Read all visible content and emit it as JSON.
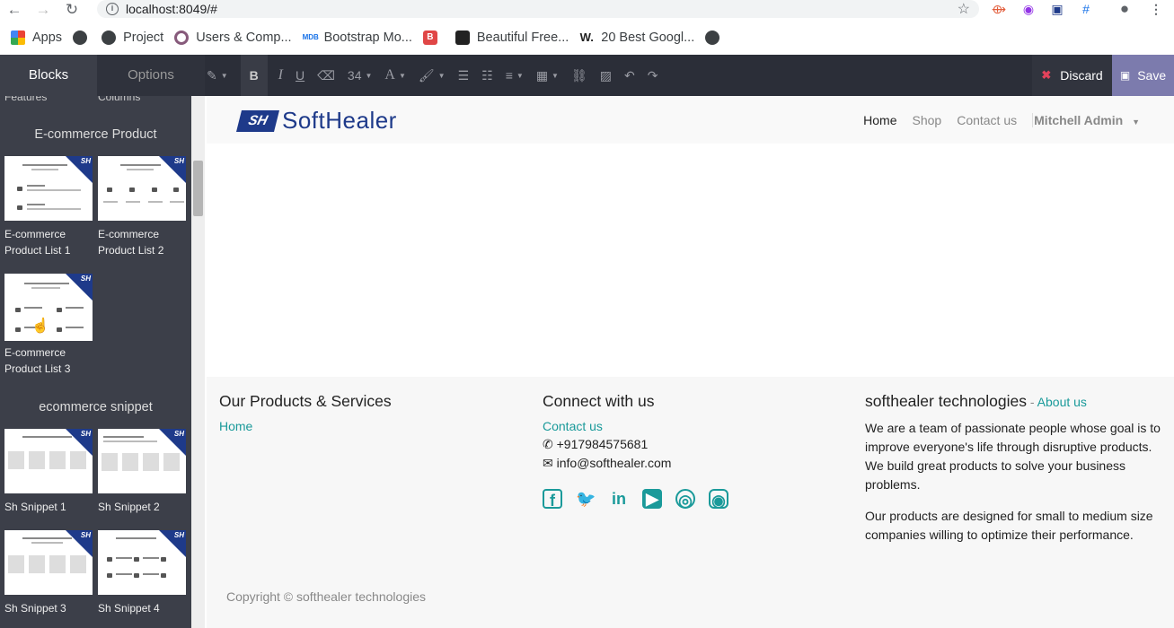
{
  "browser": {
    "url": "localhost:8049/#",
    "bookmarks": [
      "Apps",
      "Project",
      "Users & Comp...",
      "Bootstrap Mo...",
      "Beautiful Free...",
      "20 Best Googl..."
    ]
  },
  "editor": {
    "tabs": {
      "blocks": "Blocks",
      "options": "Options"
    },
    "font_size": "34",
    "discard_label": "Discard",
    "save_label": "Save"
  },
  "sidebar": {
    "cut_labels": [
      "Features",
      "Columns"
    ],
    "section1_title": "E-commerce Product",
    "section1_items": [
      "E-commerce Product List 1",
      "E-commerce Product List 2",
      "E-commerce Product List 3"
    ],
    "section2_title": "ecommerce snippet",
    "section2_items": [
      "Sh Snippet 1",
      "Sh Snippet 2",
      "Sh Snippet 3",
      "Sh Snippet 4"
    ]
  },
  "site": {
    "logo_mark": "SH",
    "logo_text": "SoftHealer",
    "nav": [
      "Home",
      "Shop",
      "Contact us"
    ],
    "user": "Mitchell Admin",
    "footer": {
      "col1_title": "Our Products & Services",
      "col1_link": "Home",
      "col2_title": "Connect with us",
      "col2_link": "Contact us",
      "phone": "+917984575681",
      "email": "info@softhealer.com",
      "col3_title": "softhealer technologies",
      "col3_dash": " - ",
      "col3_link": "About us",
      "about_p1": "We are a team of passionate people whose goal is to improve everyone's life through disruptive products. We build great products to solve your business problems.",
      "about_p2": "Our products are designed for small to medium size companies willing to optimize their performance.",
      "copyright": "Copyright © softhealer technologies"
    }
  }
}
